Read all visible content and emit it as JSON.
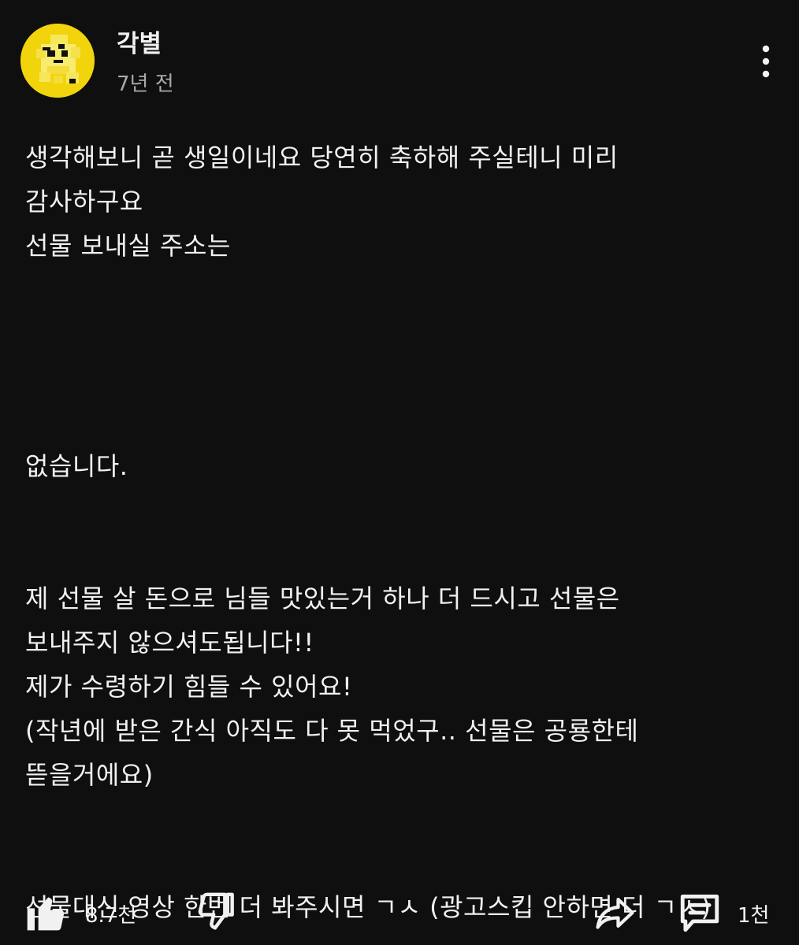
{
  "comment": {
    "author": "각별",
    "time": "7년 전",
    "body_lines": [
      "생각해보니 곧 생일이네요 당연히 축하해 주실테니 미리",
      "감사하구요",
      "선물 보내실 주소는",
      "",
      "",
      "",
      "",
      "없습니다.",
      "",
      "",
      "제 선물 살 돈으로 님들 맛있는거 하나 더 드시고 선물은",
      "보내주지 않으셔도됩니다!!",
      "제가 수령하기 힘들 수 있어요!",
      "(작년에 받은 간식 아직도 다 못 먹었구.. 선물은 공룡한테",
      "뜯을거에요)",
      "",
      "",
      "선물대신 영상 한번 더 봐주시면 ㄱㅅ (광고스킵 안하면 더 ㄱㅅ)"
    ]
  },
  "actions": {
    "like_count": "8.7천",
    "reply_count": "1천",
    "icons": [
      "thumb-up-icon",
      "thumb-down-icon",
      "share-icon",
      "comment-icon",
      "more-vert-icon"
    ]
  },
  "colors": {
    "background": "#0f0f0f",
    "text": "#f1f1f1",
    "secondary_text": "#aaaaaa",
    "avatar": "#f2d40c"
  }
}
